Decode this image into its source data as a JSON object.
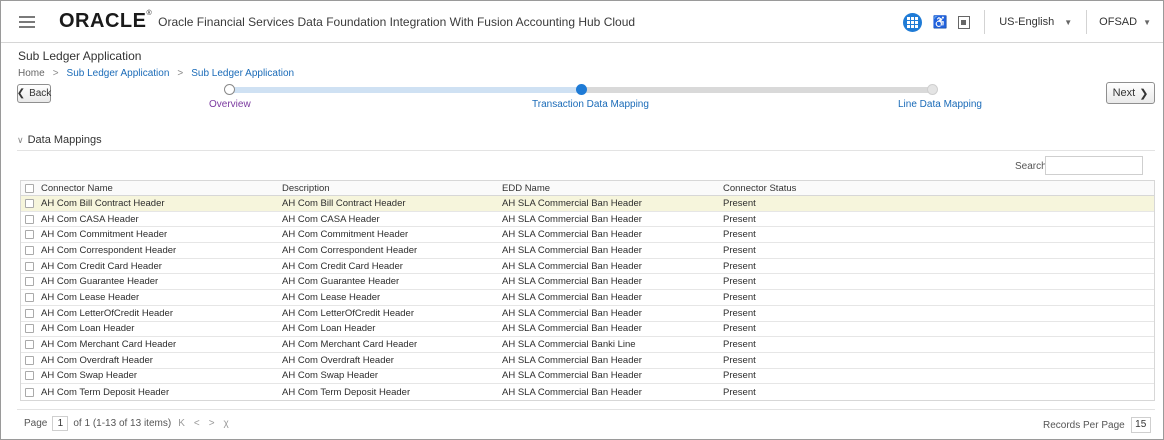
{
  "header": {
    "logo": "ORACLE",
    "logo_mark": "®",
    "title": "Oracle Financial Services Data Foundation Integration With Fusion Accounting Hub Cloud",
    "language": "US-English",
    "user": "OFSAD",
    "caret": "▼"
  },
  "page": {
    "title": "Sub Ledger Application",
    "breadcrumb": [
      "Home",
      "Sub Ledger Application",
      "Sub Ledger Application"
    ],
    "breadcrumb_sep": ">"
  },
  "train": {
    "back_label": "Back",
    "next_label": "Next",
    "stops": [
      "Overview",
      "Transaction Data Mapping",
      "Line Data Mapping"
    ],
    "current_step": 2
  },
  "section": {
    "title": "Data Mappings",
    "search_label": "Search",
    "search_value": ""
  },
  "table": {
    "columns": [
      "Connector Name",
      "Description",
      "EDD Name",
      "Connector Status"
    ],
    "rows": [
      [
        "AH Com Bill Contract Header",
        "AH Com Bill Contract Header",
        "AH SLA Commercial Ban Header",
        "Present"
      ],
      [
        "AH Com CASA Header",
        "AH Com CASA Header",
        "AH SLA Commercial Ban Header",
        "Present"
      ],
      [
        "AH Com Commitment Header",
        "AH Com Commitment Header",
        "AH SLA Commercial Ban Header",
        "Present"
      ],
      [
        "AH Com Correspondent Header",
        "AH Com Correspondent Header",
        "AH SLA Commercial Ban Header",
        "Present"
      ],
      [
        "AH Com Credit Card Header",
        "AH Com Credit Card Header",
        "AH SLA Commercial Ban Header",
        "Present"
      ],
      [
        "AH Com Guarantee Header",
        "AH Com Guarantee Header",
        "AH SLA Commercial Ban Header",
        "Present"
      ],
      [
        "AH Com Lease Header",
        "AH Com Lease Header",
        "AH SLA Commercial Ban Header",
        "Present"
      ],
      [
        "AH Com LetterOfCredit Header",
        "AH Com LetterOfCredit Header",
        "AH SLA Commercial Ban Header",
        "Present"
      ],
      [
        "AH Com Loan Header",
        "AH Com Loan Header",
        "AH SLA Commercial Ban Header",
        "Present"
      ],
      [
        "AH Com Merchant Card Header",
        "AH Com Merchant Card Header",
        "AH SLA Commercial Banki Line",
        "Present"
      ],
      [
        "AH Com Overdraft Header",
        "AH Com Overdraft Header",
        "AH SLA Commercial Ban Header",
        "Present"
      ],
      [
        "AH Com Swap Header",
        "AH Com Swap Header",
        "AH SLA Commercial Ban Header",
        "Present"
      ],
      [
        "AH Com Term Deposit Header",
        "AH Com Term Deposit Header",
        "AH SLA Commercial Ban Header",
        "Present"
      ]
    ],
    "selected_row": 0
  },
  "pagination": {
    "page_label": "Page",
    "page": "1",
    "summary": "of 1 (1-13 of 13 items)",
    "first": "K",
    "prev": "<",
    "next": ">",
    "last": "χ",
    "rpp_label": "Records Per Page",
    "rpp_value": "15"
  },
  "colors": {
    "accent": "#1f7bd6",
    "link": "#1a6bb8",
    "visited": "#7b3aa0",
    "selected_row": "#f6f5dc"
  }
}
